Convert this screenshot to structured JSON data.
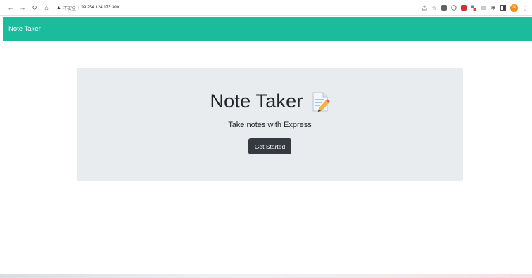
{
  "browser": {
    "security_label": "不安全",
    "url": "99.254.124.173:3001"
  },
  "navbar": {
    "brand": "Note Taker",
    "color": "#1abc9c"
  },
  "hero": {
    "title": "Note Taker",
    "subtitle": "Take notes with Express",
    "button_label": "Get Started",
    "icon": "memo-icon"
  },
  "profile": {
    "avatar_letter": "N",
    "avatar_color": "#f28b22"
  }
}
